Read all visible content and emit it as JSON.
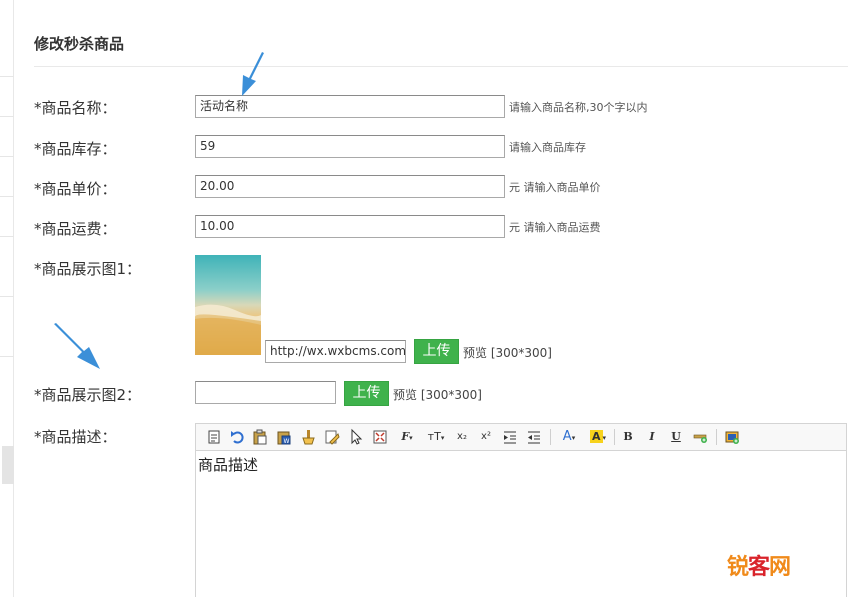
{
  "page": {
    "title": "修改秒杀商品"
  },
  "form": {
    "name": {
      "label": "*商品名称：",
      "value": "活动名称",
      "hint": "请输入商品名称,30个字以内"
    },
    "stock": {
      "label": "*商品库存：",
      "value": "59",
      "hint": "请输入商品库存"
    },
    "price": {
      "label": "*商品单价：",
      "value": "20.00",
      "hint": "元 请输入商品单价"
    },
    "freight": {
      "label": "*商品运费：",
      "value": "10.00",
      "hint": "元 请输入商品运费"
    },
    "image1": {
      "label": "*商品展示图1：",
      "url": "http://wx.wxbcms.com/",
      "upload": "上传",
      "preview": "预览 [300*300]"
    },
    "image2": {
      "label": "*商品展示图2：",
      "value": "",
      "upload": "上传",
      "preview": "预览 [300*300]"
    },
    "description": {
      "label": "*商品描述：",
      "content": "商品描述"
    }
  },
  "editor": {
    "toolbar": [
      "source-icon",
      "undo-icon",
      "paste-icon",
      "paste-word-icon",
      "format-brush-icon",
      "clear-format-icon",
      "select-icon",
      "fullscreen-icon",
      "font-family-icon",
      "font-size-icon",
      "subscript-icon",
      "superscript-icon",
      "indent-icon",
      "outdent-icon",
      "font-color-icon",
      "highlight-icon",
      "bold-icon",
      "italic-icon",
      "underline-icon",
      "strikethrough-icon",
      "image-icon"
    ],
    "labels": {
      "font_family": "F",
      "font_size": "тT",
      "subscript": "x₂",
      "superscript": "x²",
      "font_color": "A",
      "highlight": "A",
      "bold": "B",
      "italic": "I",
      "underline": "U"
    }
  },
  "watermark": {
    "part1": "锐",
    "part2": "客",
    "part3": "网"
  },
  "colors": {
    "upload_button": "#3fb24c",
    "arrow": "#3b8fd8",
    "watermark_orange": "#f08a1a",
    "watermark_red": "#d9232a"
  }
}
